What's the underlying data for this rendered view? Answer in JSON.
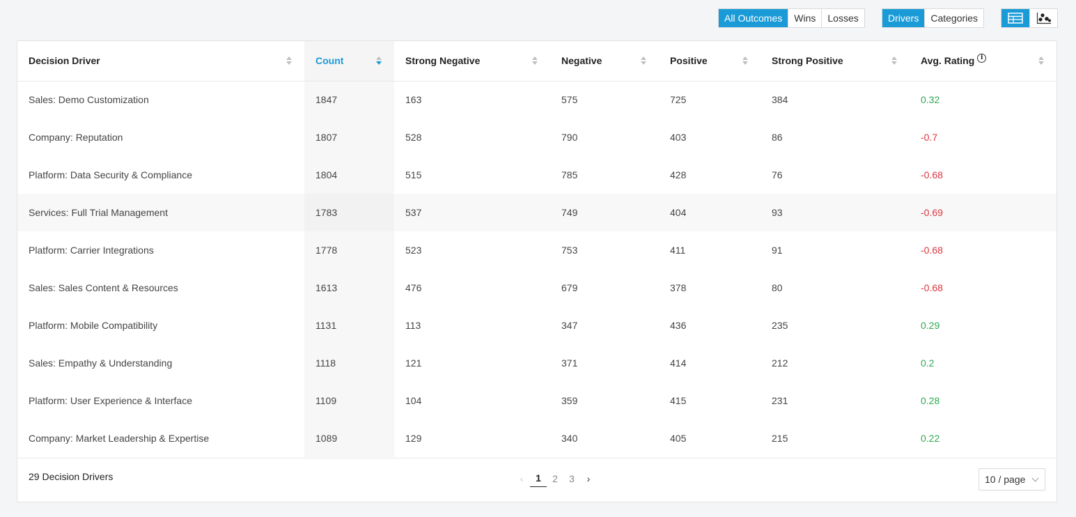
{
  "filters": {
    "outcomes": [
      "All Outcomes",
      "Wins",
      "Losses"
    ],
    "outcome_active": "All Outcomes",
    "modes": [
      "Drivers",
      "Categories"
    ],
    "mode_active": "Drivers",
    "views": [
      "table-icon",
      "scatter-icon"
    ],
    "view_active": "table-icon"
  },
  "colors": {
    "accent": "#1a9bd7",
    "positive": "#2fa84f",
    "negative": "#d9363e"
  },
  "table": {
    "columns": [
      "Decision Driver",
      "Count",
      "Strong Negative",
      "Negative",
      "Positive",
      "Strong Positive",
      "Avg. Rating"
    ],
    "sorted_column": "Count",
    "rows": [
      [
        "Sales: Demo Customization",
        "1847",
        "163",
        "575",
        "725",
        "384",
        "0.32"
      ],
      [
        "Company: Reputation",
        "1807",
        "528",
        "790",
        "403",
        "86",
        "-0.7"
      ],
      [
        "Platform: Data Security & Compliance",
        "1804",
        "515",
        "785",
        "428",
        "76",
        "-0.68"
      ],
      [
        "Services: Full Trial Management",
        "1783",
        "537",
        "749",
        "404",
        "93",
        "-0.69"
      ],
      [
        "Platform: Carrier Integrations",
        "1778",
        "523",
        "753",
        "411",
        "91",
        "-0.68"
      ],
      [
        "Sales: Sales Content & Resources",
        "1613",
        "476",
        "679",
        "378",
        "80",
        "-0.68"
      ],
      [
        "Platform: Mobile Compatibility",
        "1131",
        "113",
        "347",
        "436",
        "235",
        "0.29"
      ],
      [
        "Sales: Empathy & Understanding",
        "1118",
        "121",
        "371",
        "414",
        "212",
        "0.2"
      ],
      [
        "Platform: User Experience & Interface",
        "1109",
        "104",
        "359",
        "415",
        "231",
        "0.28"
      ],
      [
        "Company: Market Leadership & Expertise",
        "1089",
        "129",
        "340",
        "405",
        "215",
        "0.22"
      ]
    ]
  },
  "footer": {
    "total_label": "29 Decision Drivers",
    "pages": [
      "1",
      "2",
      "3"
    ],
    "current_page": "1",
    "page_size": "10 / page"
  }
}
